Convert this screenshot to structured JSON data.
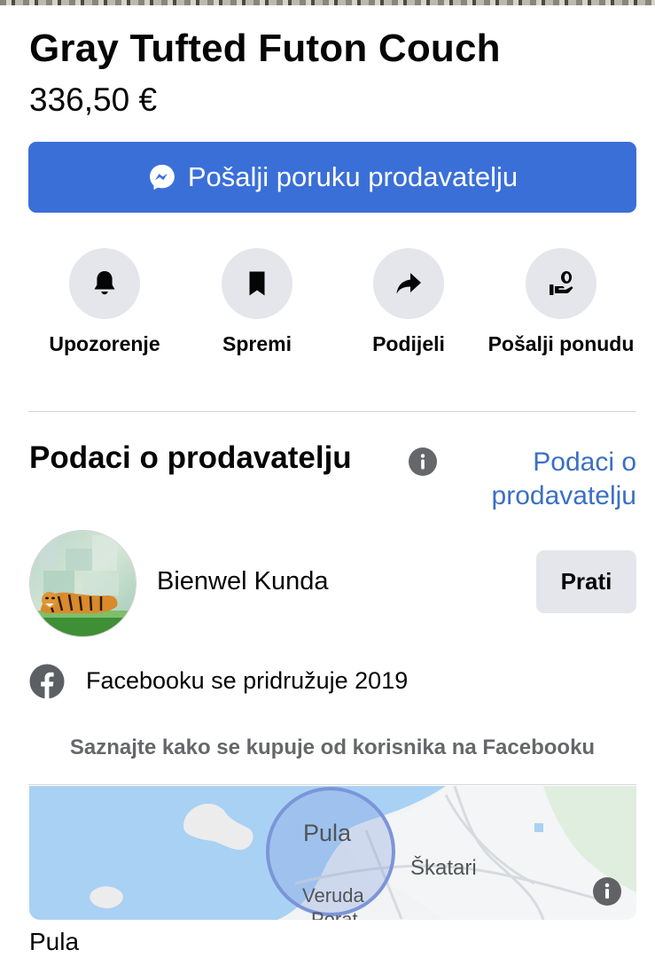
{
  "listing": {
    "title": "Gray Tufted Futon Couch",
    "price": "336,50 €"
  },
  "message_button": {
    "label": "Pošalji poruku prodavatelju",
    "icon": "messenger-icon",
    "color": "#3a6fd8"
  },
  "actions": [
    {
      "label": "Upozorenje",
      "icon": "bell-icon"
    },
    {
      "label": "Spremi",
      "icon": "bookmark-icon"
    },
    {
      "label": "Podijeli",
      "icon": "share-icon"
    },
    {
      "label": "Pošalji ponudu",
      "icon": "offer-icon"
    }
  ],
  "seller_section": {
    "heading": "Podaci o prodavatelju",
    "link_label": "Podaci o prodavatelju",
    "link_color": "#3b6fc4",
    "name": "Bienwel Kunda",
    "follow_label": "Prati",
    "joined": "Facebooku se pridružuje 2019",
    "learn_more": "Saznajte kako se kupuje od korisnika na Facebooku"
  },
  "map": {
    "labels": {
      "city": "Pula",
      "area1": "Škatari",
      "area2": "Veruda",
      "area3": "Porat"
    }
  },
  "location": "Pula"
}
